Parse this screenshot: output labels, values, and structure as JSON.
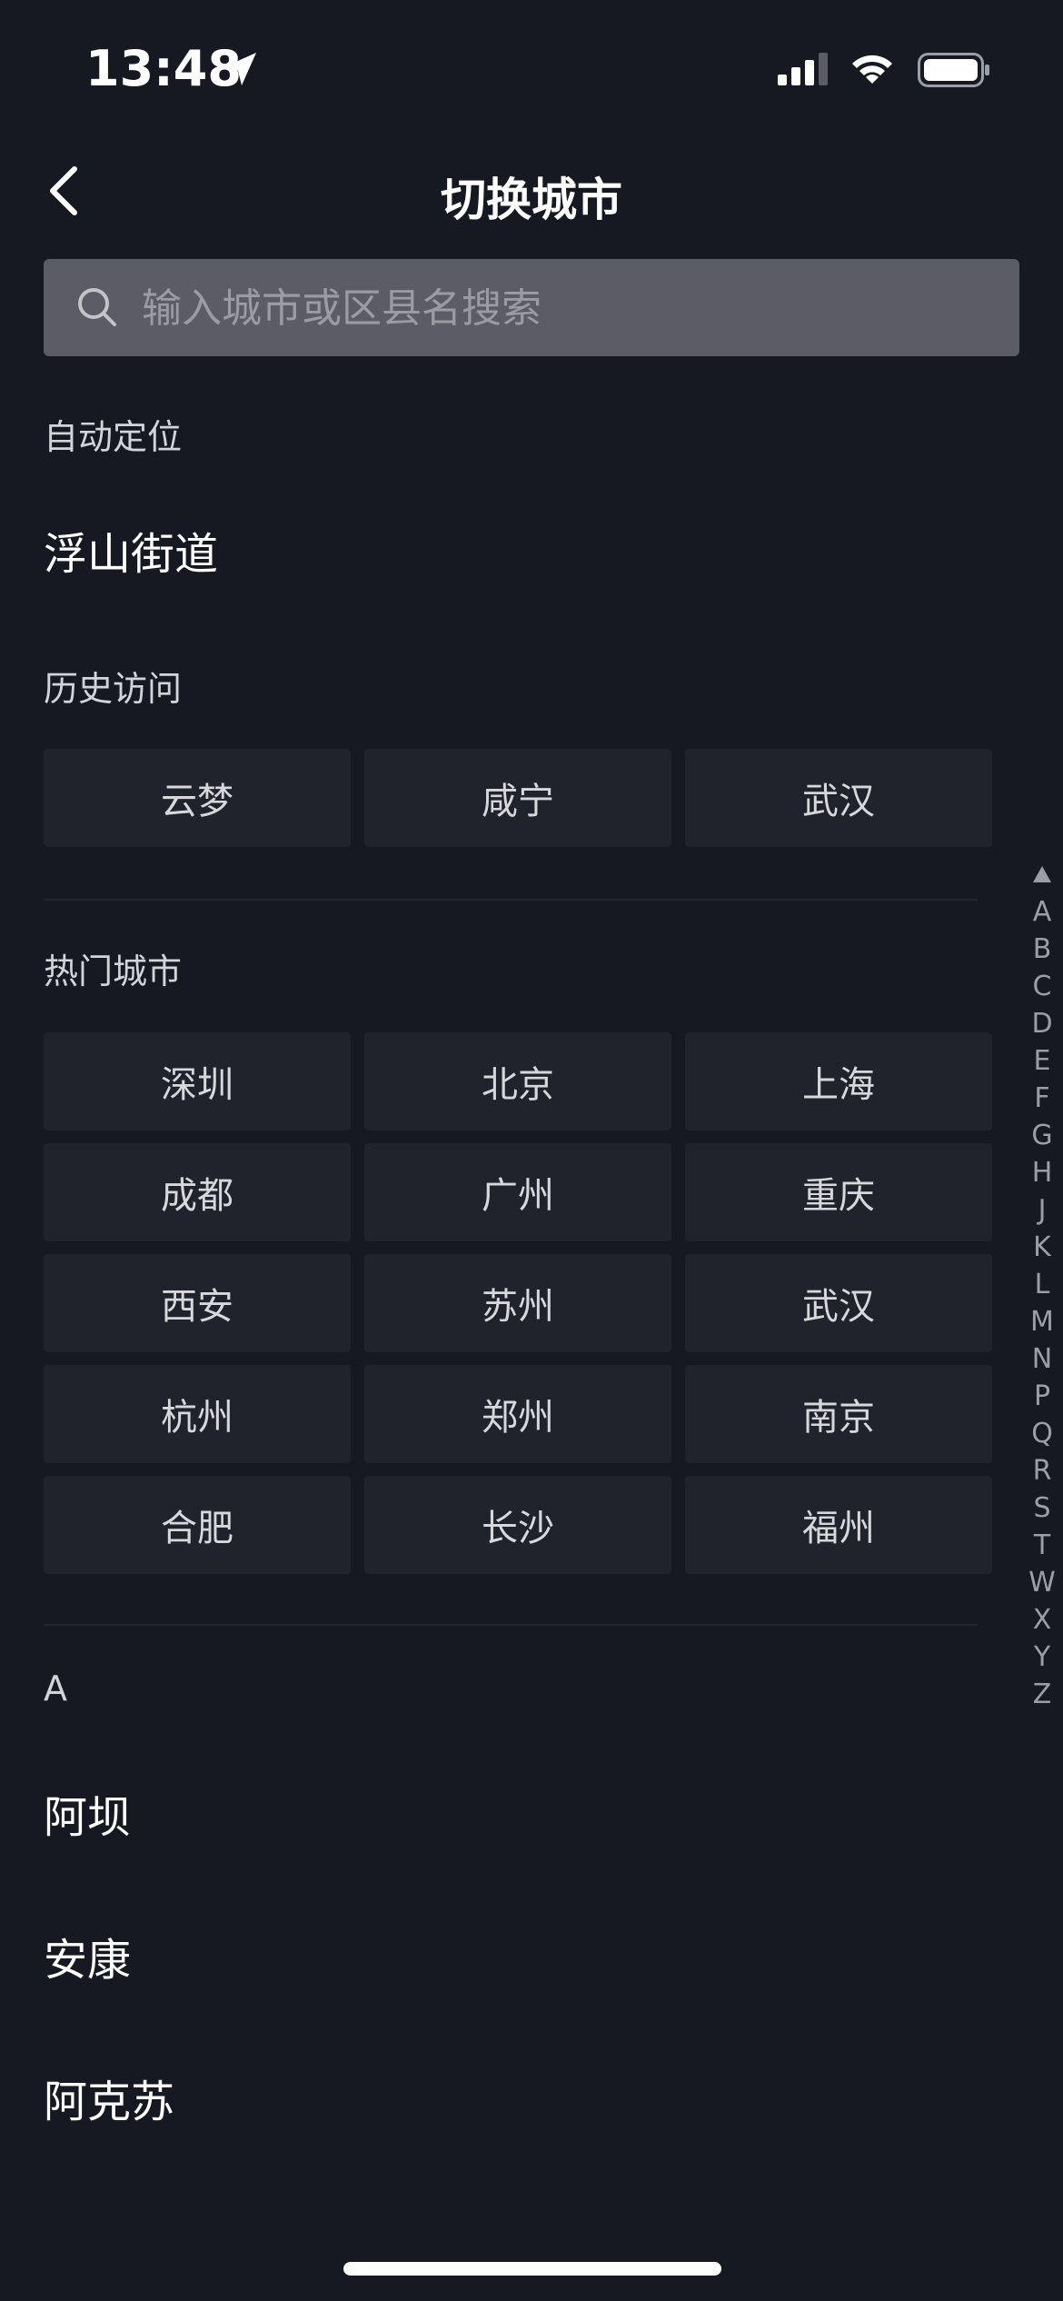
{
  "status": {
    "time": "13:48"
  },
  "nav": {
    "title": "切换城市"
  },
  "search": {
    "placeholder": "输入城市或区县名搜索"
  },
  "auto_location": {
    "title": "自动定位",
    "city": "浮山街道"
  },
  "history": {
    "title": "历史访问",
    "cities": [
      "云梦",
      "咸宁",
      "武汉"
    ]
  },
  "hot": {
    "title": "热门城市",
    "cities": [
      "深圳",
      "北京",
      "上海",
      "成都",
      "广州",
      "重庆",
      "西安",
      "苏州",
      "武汉",
      "杭州",
      "郑州",
      "南京",
      "合肥",
      "长沙",
      "福州"
    ]
  },
  "list": {
    "letter": "A",
    "cities": [
      "阿坝",
      "安康",
      "阿克苏"
    ]
  },
  "index": [
    "A",
    "B",
    "C",
    "D",
    "E",
    "F",
    "G",
    "H",
    "J",
    "K",
    "L",
    "M",
    "N",
    "P",
    "Q",
    "R",
    "S",
    "T",
    "W",
    "X",
    "Y",
    "Z"
  ],
  "colors": {
    "background": "#161922",
    "cell": "#20232c",
    "search_bg": "#5b5c66"
  }
}
